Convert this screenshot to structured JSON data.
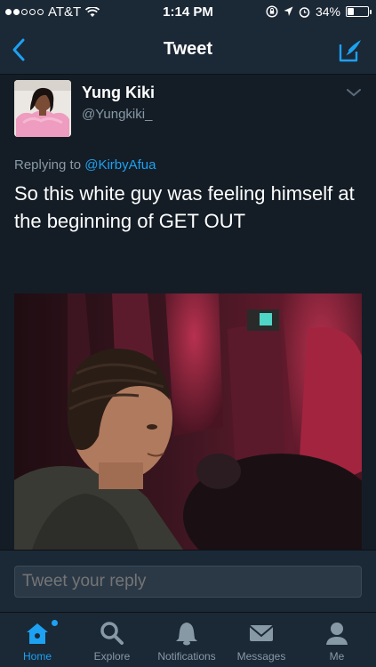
{
  "status_bar": {
    "carrier": "AT&T",
    "time": "1:14 PM",
    "battery_percent": "34%",
    "battery_level": 0.34,
    "signal_bars_filled": 2
  },
  "nav": {
    "title": "Tweet"
  },
  "tweet": {
    "author_name": "Yung Kiki",
    "author_handle": "@Yungkiki_",
    "replying_prefix": "Replying to ",
    "replying_to": "@KirbyAfua",
    "text": "So this white guy was feeling himself at the beginning of GET OUT"
  },
  "reply": {
    "placeholder": "Tweet your reply"
  },
  "tabs": [
    {
      "label": "Home",
      "icon": "home-icon",
      "active": true
    },
    {
      "label": "Explore",
      "icon": "search-icon",
      "active": false
    },
    {
      "label": "Notifications",
      "icon": "bell-icon",
      "active": false
    },
    {
      "label": "Messages",
      "icon": "envelope-icon",
      "active": false
    },
    {
      "label": "Me",
      "icon": "person-icon",
      "active": false
    }
  ],
  "colors": {
    "accent": "#1da1f2",
    "background": "#141d26",
    "bar": "#1b2836",
    "muted_text": "#8899a6"
  }
}
